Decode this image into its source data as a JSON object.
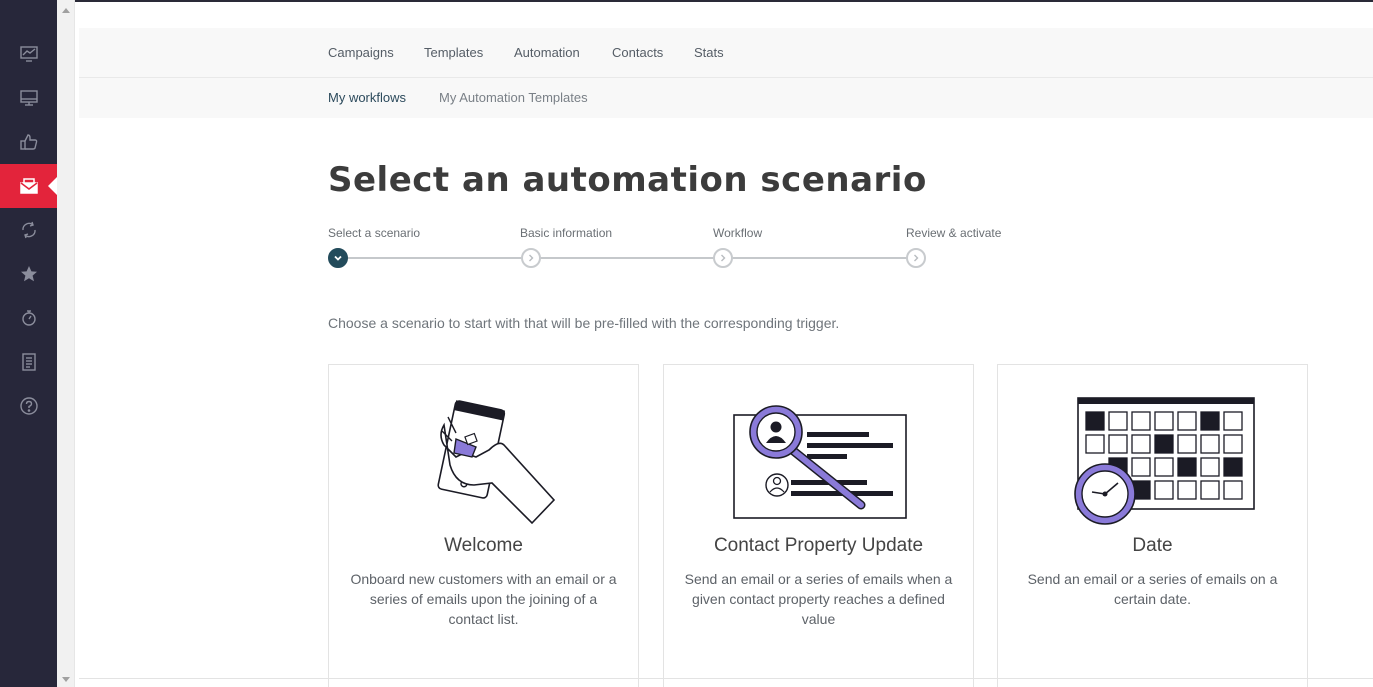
{
  "nav": {
    "tabs": [
      "Campaigns",
      "Templates",
      "Automation",
      "Contacts",
      "Stats"
    ],
    "subtabs": [
      "My workflows",
      "My Automation Templates"
    ]
  },
  "page": {
    "title": "Select an automation scenario",
    "intro": "Choose a scenario to start with that will be pre-filled with the corresponding trigger."
  },
  "stepper": {
    "steps": [
      "Select a scenario",
      "Basic information",
      "Workflow",
      "Review & activate"
    ]
  },
  "cards": [
    {
      "title": "Welcome",
      "description": "Onboard new customers with an email or a series of emails upon the joining of a contact list."
    },
    {
      "title": "Contact Property Update",
      "description": "Send an email or a series of emails when a given contact property reaches a defined value"
    },
    {
      "title": "Date",
      "description": "Send an email or a series of emails on a certain date."
    }
  ],
  "sidebar": {
    "icons": [
      "dashboard-icon",
      "monitor-icon",
      "thumbs-up-icon",
      "email-campaign-icon",
      "refresh-icon",
      "star-icon",
      "timer-icon",
      "reports-icon",
      "help-icon"
    ],
    "active_index": 3
  },
  "colors": {
    "sidebar": "#27273a",
    "active": "#e3243b",
    "accent_purple": "#8a7ad9",
    "step_done": "#234b5b"
  }
}
